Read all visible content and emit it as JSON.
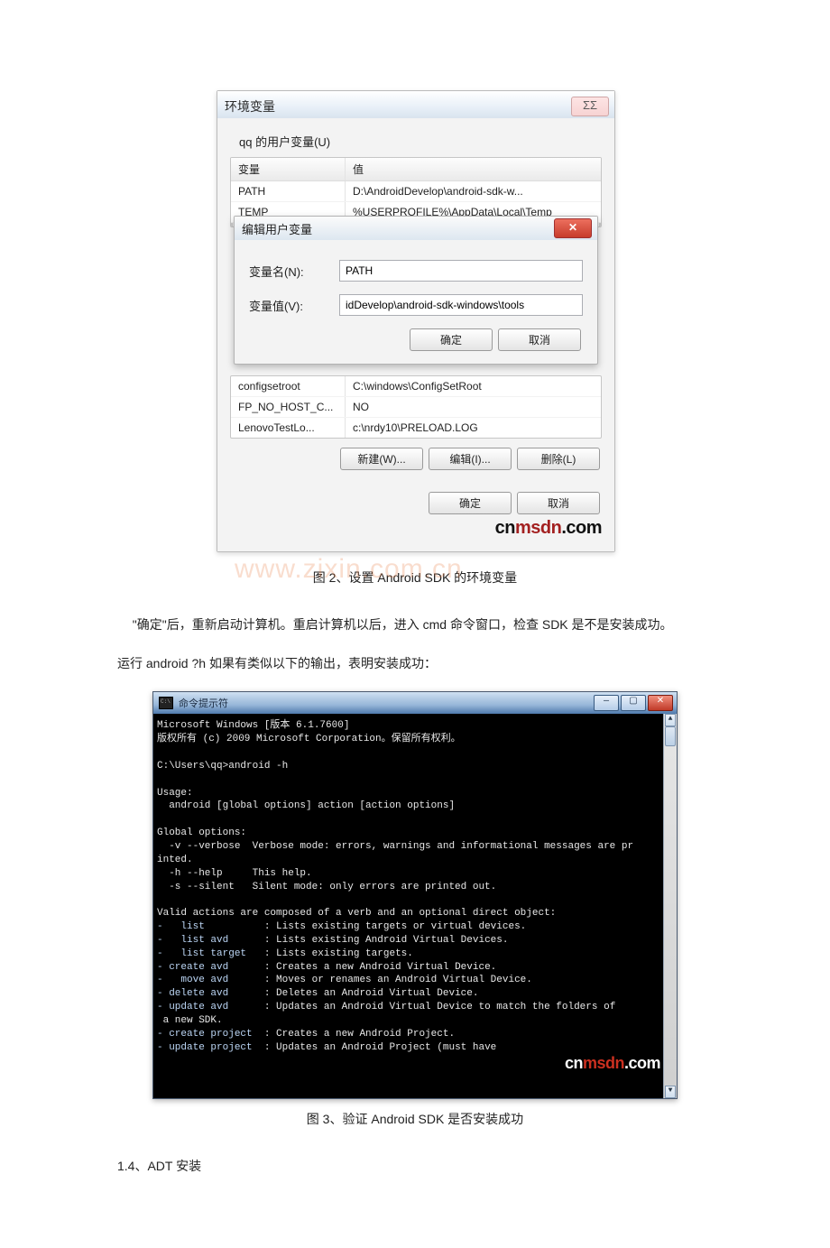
{
  "envDialog": {
    "title": "环境变量",
    "close_label": "ΣΣ",
    "group_label": "qq 的用户变量(U)",
    "table_headers": {
      "var": "变量",
      "value": "值"
    },
    "user_rows": [
      {
        "var": "PATH",
        "value": "D:\\AndroidDevelop\\android-sdk-w..."
      },
      {
        "var": "TEMP",
        "value": "%USERPROFILE%\\AppData\\Local\\Temp"
      }
    ],
    "sys_rows": [
      {
        "var": "configsetroot",
        "value": "C:\\windows\\ConfigSetRoot"
      },
      {
        "var": "FP_NO_HOST_C...",
        "value": "NO"
      },
      {
        "var": "LenovoTestLo...",
        "value": "c:\\nrdy10\\PRELOAD.LOG"
      }
    ],
    "buttons": {
      "new": "新建(W)...",
      "edit": "编辑(I)...",
      "delete": "删除(L)",
      "ok": "确定",
      "cancel": "取消"
    },
    "edit_dialog": {
      "title": "编辑用户变量",
      "name_label": "变量名(N):",
      "value_label": "变量值(V):",
      "name_value": "PATH",
      "value_value": "idDevelop\\android-sdk-windows\\tools",
      "ok": "确定",
      "cancel": "取消"
    },
    "brand": {
      "cn": "cn",
      "msdn": "msdn",
      "com": ".com"
    }
  },
  "caption2": "图 2、设置 Android SDK 的环境变量",
  "para1": "\"确定\"后，重新启动计算机。重启计算机以后，进入 cmd 命令窗口，检查 SDK 是不是安装成功。",
  "para2": "运行 android ?h 如果有类似以下的输出，表明安装成功：",
  "watermark": "www.zixin.com.cn",
  "cmd": {
    "title": "命令提示符",
    "lines": {
      "l1": "Microsoft Windows [版本 6.1.7600]",
      "l2": "版权所有 (c) 2009 Microsoft Corporation。保留所有权利。",
      "l3": "C:\\Users\\qq>android -h",
      "l4": "Usage:",
      "l5": "  android [global options] action [action options]",
      "l6": "Global options:",
      "l7": "  -v --verbose  Verbose mode: errors, warnings and informational messages are pr",
      "l7b": "inted.",
      "l8": "  -h --help     This help.",
      "l9": "  -s --silent   Silent mode: only errors are printed out.",
      "l10": "Valid actions are composed of a verb and an optional direct object:",
      "a1k": "-   list",
      "a1v": ": Lists existing targets or virtual devices.",
      "a2k": "-   list avd",
      "a2v": ": Lists existing Android Virtual Devices.",
      "a3k": "-   list target",
      "a3v": ": Lists existing targets.",
      "a4k": "- create avd",
      "a4v": ": Creates a new Android Virtual Device.",
      "a5k": "-   move avd",
      "a5v": ": Moves or renames an Android Virtual Device.",
      "a6k": "- delete avd",
      "a6v": ": Deletes an Android Virtual Device.",
      "a7k": "- update avd",
      "a7v": ": Updates an Android Virtual Device to match the folders of",
      "a7b": " a new SDK.",
      "a8k": "- create project",
      "a8v": ": Creates a new Android Project.",
      "a9k": "- update project",
      "a9v": ": Updates an Android Project (must have "
    },
    "brand": {
      "cn": "cn",
      "msdn": "msdn",
      "com": ".com"
    }
  },
  "caption3": "图 3、验证 Android SDK 是否安装成功",
  "section14": "1.4、ADT 安装"
}
